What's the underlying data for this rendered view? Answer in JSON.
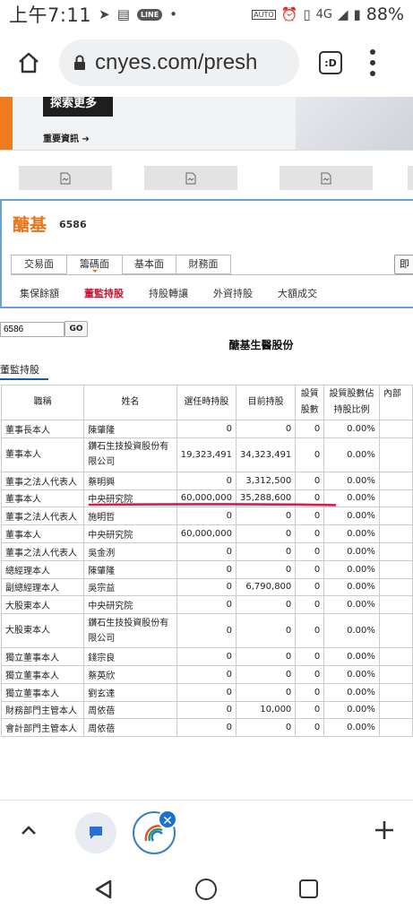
{
  "status_bar": {
    "time": "上午7:11",
    "line_label": "LINE",
    "auto_label": "AUTO",
    "network": "4G",
    "battery": "88%"
  },
  "browser": {
    "url": "cnyes.com/presh",
    "tabs_label": ":D"
  },
  "banner": {
    "explore_label": "探索更多",
    "more_label": "重要資訊 ➔"
  },
  "stock": {
    "name": "醣基",
    "code": "6586",
    "main_tabs": [
      {
        "label": "交易面"
      },
      {
        "label": "籌碼面"
      },
      {
        "label": "基本面"
      },
      {
        "label": "財務面"
      }
    ],
    "right_button": "即",
    "sub_tabs": [
      {
        "label": "集保餘額"
      },
      {
        "label": "董監持股"
      },
      {
        "label": "持股轉讓"
      },
      {
        "label": "外資持股"
      },
      {
        "label": "大額成交"
      }
    ]
  },
  "search": {
    "code_value": "6586",
    "go_label": "GO"
  },
  "company_title": "醣基生醫股份",
  "section_title": "董監持股",
  "table": {
    "headers": [
      "職稱",
      "姓名",
      "選任時持股",
      "目前持股",
      "設質股數",
      "設質股數佔持股比例",
      "內部"
    ],
    "header_lines": {
      "pledged_1": "設質",
      "pledged_2": "股數",
      "ratio_1": "設質股數佔",
      "ratio_2": "持股比例",
      "inner": "內部"
    },
    "rows": [
      {
        "title": "董事長本人",
        "name": "陳肇隆",
        "elected": "0",
        "current": "0",
        "pledged": "0",
        "ratio": "0.00%"
      },
      {
        "title": "董事本人",
        "name": "鑽石生技投資股份有限公司",
        "elected": "19,323,491",
        "current": "34,323,491",
        "pledged": "0",
        "ratio": "0.00%"
      },
      {
        "title": "董事之法人代表人",
        "name": "蔡明興",
        "elected": "0",
        "current": "3,312,500",
        "pledged": "0",
        "ratio": "0.00%"
      },
      {
        "title": "董事本人",
        "name": "中央研究院",
        "elected": "60,000,000",
        "current": "35,288,600",
        "pledged": "0",
        "ratio": "0.00%"
      },
      {
        "title": "董事之法人代表人",
        "name": "施明哲",
        "elected": "0",
        "current": "0",
        "pledged": "0",
        "ratio": "0.00%"
      },
      {
        "title": "董事本人",
        "name": "中央研究院",
        "elected": "60,000,000",
        "current": "0",
        "pledged": "0",
        "ratio": "0.00%"
      },
      {
        "title": "董事之法人代表人",
        "name": "吳金洌",
        "elected": "0",
        "current": "0",
        "pledged": "0",
        "ratio": "0.00%"
      },
      {
        "title": "總經理本人",
        "name": "陳肇隆",
        "elected": "0",
        "current": "0",
        "pledged": "0",
        "ratio": "0.00%"
      },
      {
        "title": "副總經理本人",
        "name": "吳宗益",
        "elected": "0",
        "current": "6,790,800",
        "pledged": "0",
        "ratio": "0.00%"
      },
      {
        "title": "大股東本人",
        "name": "中央研究院",
        "elected": "0",
        "current": "0",
        "pledged": "0",
        "ratio": "0.00%"
      },
      {
        "title": "大股東本人",
        "name": "鑽石生技投資股份有限公司",
        "elected": "0",
        "current": "0",
        "pledged": "0",
        "ratio": "0.00%"
      },
      {
        "title": "獨立董事本人",
        "name": "錢宗良",
        "elected": "0",
        "current": "0",
        "pledged": "0",
        "ratio": "0.00%"
      },
      {
        "title": "獨立董事本人",
        "name": "蔡英欣",
        "elected": "0",
        "current": "0",
        "pledged": "0",
        "ratio": "0.00%"
      },
      {
        "title": "獨立董事本人",
        "name": "劉玄達",
        "elected": "0",
        "current": "0",
        "pledged": "0",
        "ratio": "0.00%"
      },
      {
        "title": "財務部門主管本人",
        "name": "周依蓓",
        "elected": "0",
        "current": "10,000",
        "pledged": "0",
        "ratio": "0.00%"
      },
      {
        "title": "會計部門主管本人",
        "name": "周依蓓",
        "elected": "0",
        "current": "0",
        "pledged": "0",
        "ratio": "0.00%"
      }
    ]
  },
  "colors": {
    "accent_orange": "#e8751a",
    "active_tab_red": "#c8102e",
    "panel_border": "#6aa0d8",
    "annotation_red": "#d81b4a"
  },
  "icons": {
    "home": "home-icon",
    "lock": "lock-icon",
    "menu": "more-vert-icon",
    "up": "chevron-up-icon",
    "chat": "chat-bubble-icon",
    "close": "close-icon",
    "plus": "plus-icon"
  },
  "bottom_bar": {
    "close_label": "✕"
  }
}
